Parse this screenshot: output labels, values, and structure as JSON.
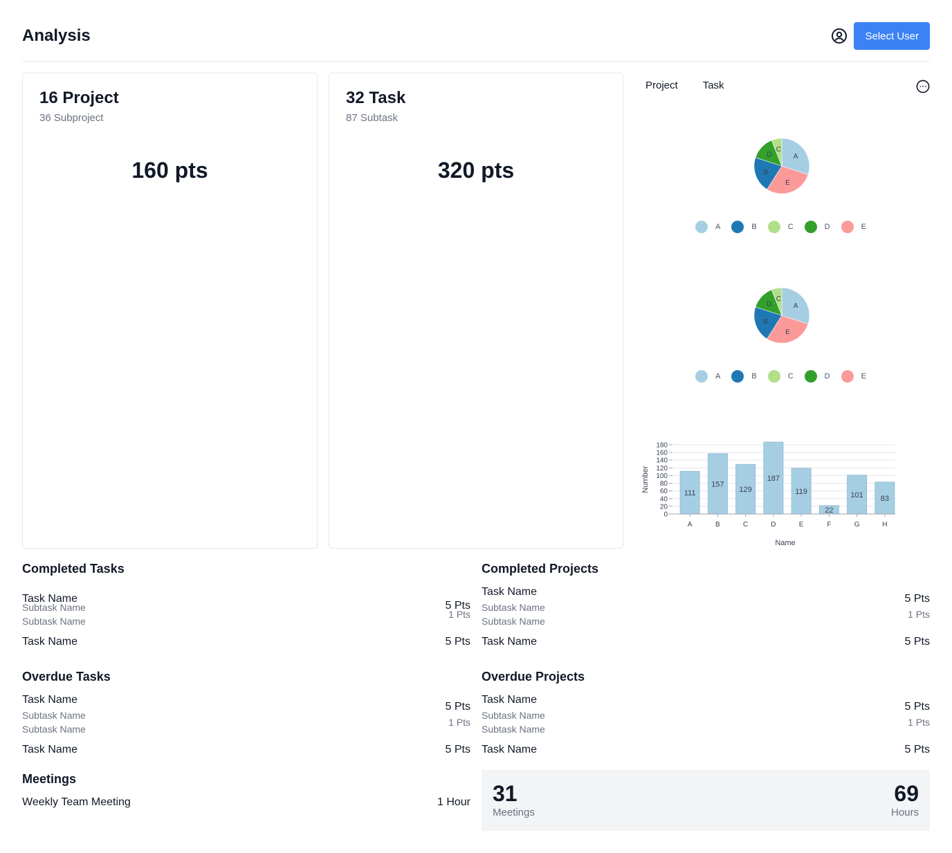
{
  "header": {
    "title": "Analysis",
    "user_icon": "user-circle-icon",
    "select_user_label": "Select User"
  },
  "project_card": {
    "title": "16 Project",
    "subtitle": "36 Subproject",
    "points": "160 pts"
  },
  "task_card": {
    "title": "32 Task",
    "subtitle": "87 Subtask",
    "points": "320 pts"
  },
  "charts": {
    "tabs": [
      "Project",
      "Task"
    ],
    "more_icon": "more-horizontal-icon"
  },
  "chart_data": [
    {
      "type": "pie",
      "labels": [
        "A",
        "B",
        "C",
        "D",
        "E"
      ],
      "values": [
        30,
        21,
        6,
        14,
        29
      ],
      "colors": [
        "#a6cee3",
        "#1f78b4",
        "#b2df8a",
        "#33a02c",
        "#fb9a99"
      ],
      "legend": "bottom"
    },
    {
      "type": "pie",
      "labels": [
        "A",
        "B",
        "C",
        "D",
        "E"
      ],
      "values": [
        30,
        21,
        6,
        14,
        29
      ],
      "colors": [
        "#a6cee3",
        "#1f78b4",
        "#b2df8a",
        "#33a02c",
        "#fb9a99"
      ],
      "legend": "bottom"
    },
    {
      "type": "bar",
      "categories": [
        "A",
        "B",
        "C",
        "D",
        "E",
        "F",
        "G",
        "H"
      ],
      "values": [
        111,
        157,
        129,
        187,
        119,
        22,
        101,
        83
      ],
      "xlabel": "Name",
      "ylabel": "Number",
      "yticks": [
        0,
        20,
        40,
        60,
        80,
        100,
        120,
        140,
        160,
        180
      ],
      "ylim": [
        0,
        187
      ],
      "color": "#a6cee3",
      "grid": true
    }
  ],
  "completed_tasks": {
    "title": "Completed Tasks",
    "items": [
      {
        "name": "Task Name",
        "pts": "5 Pts",
        "subtasks": [
          {
            "name": "Subtask Name",
            "pts": "1 Pts"
          },
          {
            "name": "Subtask Name",
            "pts": ""
          }
        ]
      },
      {
        "name": "Task Name",
        "pts": "5 Pts",
        "subtasks": []
      }
    ]
  },
  "completed_projects": {
    "title": "Completed Projects",
    "items": [
      {
        "name": "Task Name",
        "pts": "5 Pts",
        "subtasks": [
          {
            "name": "Subtask Name",
            "pts": "1 Pts"
          },
          {
            "name": "Subtask Name",
            "pts": ""
          }
        ]
      },
      {
        "name": "Task Name",
        "pts": "5 Pts",
        "subtasks": []
      }
    ]
  },
  "overdue_tasks": {
    "title": "Overdue Tasks",
    "items": [
      {
        "name": "Task Name",
        "pts": "5 Pts",
        "subtasks": [
          {
            "name": "Subtask Name",
            "pts": "1 Pts"
          },
          {
            "name": "Subtask Name",
            "pts": ""
          }
        ]
      },
      {
        "name": "Task Name",
        "pts": "5 Pts",
        "subtasks": []
      }
    ]
  },
  "overdue_projects": {
    "title": "Overdue Projects",
    "items": [
      {
        "name": "Task Name",
        "pts": "5 Pts",
        "subtasks": [
          {
            "name": "Subtask Name",
            "pts": "1 Pts"
          },
          {
            "name": "Subtask Name",
            "pts": ""
          }
        ]
      },
      {
        "name": "Task Name",
        "pts": "5 Pts",
        "subtasks": []
      }
    ]
  },
  "meetings": {
    "title": "Meetings",
    "items": [
      {
        "name": "Weekly Team Meeting",
        "duration": "1 Hour"
      }
    ]
  },
  "summary": {
    "meetings_count": "31",
    "meetings_label": "Meetings",
    "hours_count": "69",
    "hours_label": "Hours"
  }
}
